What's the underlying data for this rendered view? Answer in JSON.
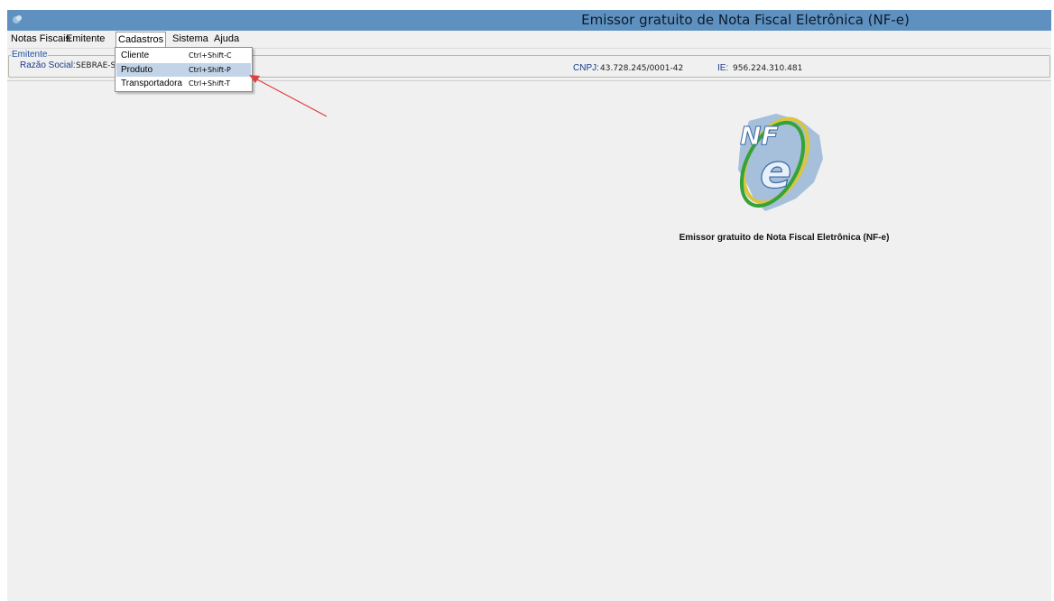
{
  "window": {
    "title": "Emissor gratuito de Nota Fiscal Eletrônica (NF-e)"
  },
  "menubar": {
    "items": [
      {
        "label": "Notas Fiscais"
      },
      {
        "label": "Emitente"
      },
      {
        "label": "Cadastros",
        "active": true
      },
      {
        "label": "Sistema"
      },
      {
        "label": "Ajuda"
      }
    ]
  },
  "emitente": {
    "group_title": "Emitente",
    "razao_social_label": "Razão Social:",
    "razao_social_value": "SEBRAE-S",
    "cnpj_label": "CNPJ:",
    "cnpj_value": "43.728.245/0001-42",
    "ie_label": "IE:",
    "ie_value": "956.224.310.481"
  },
  "cadastros_menu": {
    "items": [
      {
        "label": "Cliente",
        "shortcut": "Ctrl+Shift-C",
        "selected": false
      },
      {
        "label": "Produto",
        "shortcut": "Ctrl+Shift-P",
        "selected": true
      },
      {
        "label": "Transportadora",
        "shortcut": "Ctrl+Shift-T",
        "selected": false
      }
    ]
  },
  "main": {
    "logo_text_nf": "NF",
    "logo_text_e": "e",
    "caption": "Emissor gratuito de Nota Fiscal Eletrônica (NF-e)"
  },
  "colors": {
    "titlebar": "#5f91c0",
    "annotation_arrow": "#e04040"
  }
}
